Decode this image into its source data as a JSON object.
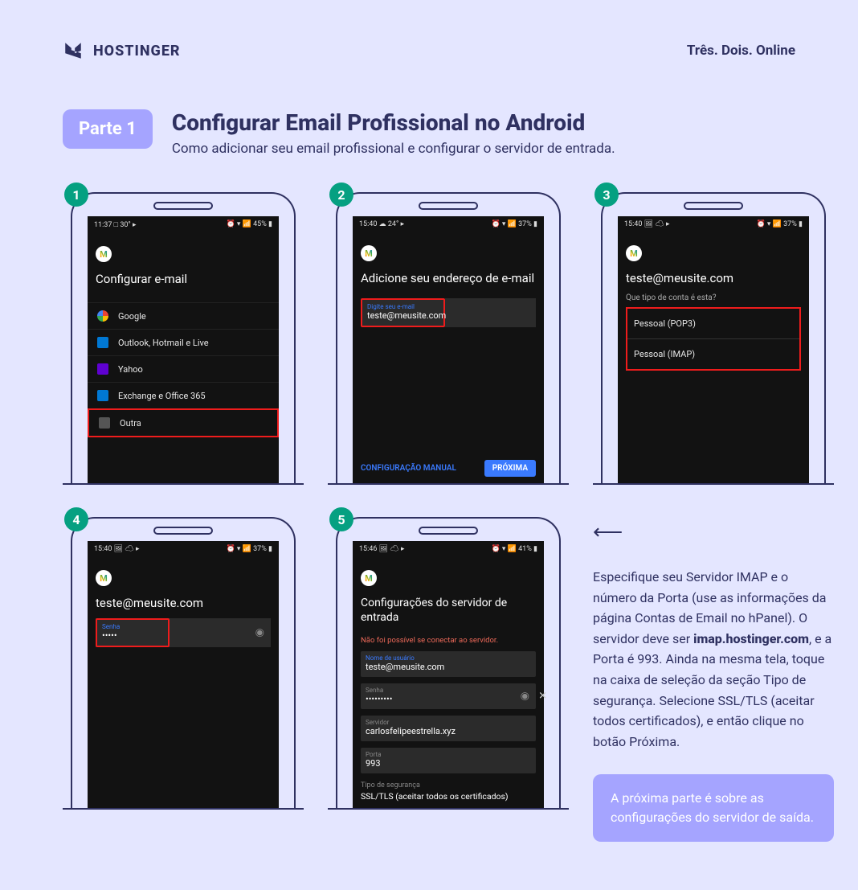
{
  "header": {
    "brand": "HOSTINGER",
    "tagline": "Três. Dois. Online"
  },
  "title": {
    "badge": "Parte 1",
    "heading": "Configurar Email Profissional no Android",
    "subheading": "Como adicionar seu email profissional e configurar o servidor de entrada."
  },
  "steps": {
    "s1": {
      "num": "1",
      "status_left": "11:37 □ 30° ▸",
      "status_right": "⏰ ▾ 📶 45% ▮",
      "title": "Configurar e-mail",
      "providers": {
        "google": "Google",
        "outlook": "Outlook, Hotmail e Live",
        "yahoo": "Yahoo",
        "exchange": "Exchange e Office 365",
        "other": "Outra"
      }
    },
    "s2": {
      "num": "2",
      "status_left": "15:40 ☁ 24° ▸",
      "status_right": "⏰ ▾ 📶 37% ▮",
      "title": "Adicione seu endereço de e-mail",
      "input_label": "Digite seu e-mail",
      "input_value": "teste@meusite.com",
      "manual": "CONFIGURAÇÃO MANUAL",
      "next": "PRÓXIMA"
    },
    "s3": {
      "num": "3",
      "status_left": "15:40 🖼 ☁ ▸",
      "status_right": "⏰ ▾ 📶 37% ▮",
      "title": "teste@meusite.com",
      "sub": "Que tipo de conta é esta?",
      "pop3": "Pessoal (POP3)",
      "imap": "Pessoal (IMAP)"
    },
    "s4": {
      "num": "4",
      "status_left": "15:40 🖼 ☁ ▸",
      "status_right": "⏰ ▾ 📶 37% ▮",
      "title": "teste@meusite.com",
      "pw_label": "Senha",
      "pw_value": "•••••"
    },
    "s5": {
      "num": "5",
      "status_left": "15:46 🖼 ☁ ▸",
      "status_right": "⏰ ▾ 📶 41% ▮",
      "title": "Configurações do servidor de entrada",
      "error": "Não foi possível se conectar ao servidor.",
      "user_label": "Nome de usuário",
      "user_value": "teste@meusite.com",
      "pw_label": "Senha",
      "pw_value": "•••••••••",
      "server_label": "Servidor",
      "server_value": "carlosfelipeestrella.xyz",
      "port_label": "Porta",
      "port_value": "993",
      "sec_label": "Tipo de segurança",
      "sec_value": "SSL/TLS (aceitar todos os certificados)"
    }
  },
  "info": {
    "text_before": "Especifique seu Servidor IMAP e o número da Porta (use as informações da página Contas de Email no hPanel). O servidor deve ser ",
    "bold": "imap.hostinger.com",
    "text_after": ", e a Porta é 993. Ainda na mesma tela, toque na caixa de seleção da seção Tipo de segurança. Selecione SSL/TLS (aceitar todos certificados), e então clique no botão Próxima.",
    "next_box": "A próxima parte é sobre as configurações do servidor de saída."
  }
}
